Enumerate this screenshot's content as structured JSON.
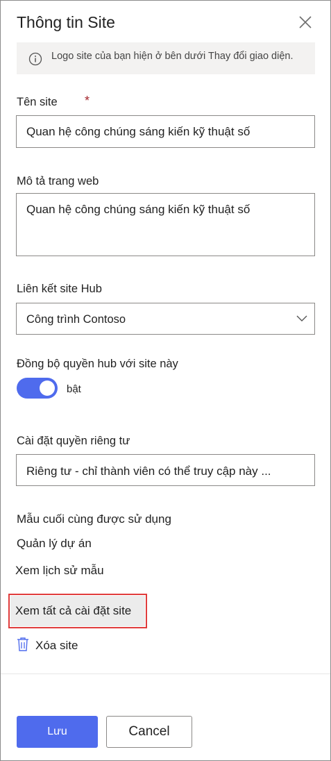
{
  "panel": {
    "title": "Thông tin Site"
  },
  "info_bar": {
    "text": "Logo site của bạn hiện ở bên dưới Thay đổi giao diện."
  },
  "site_name": {
    "label": "Tên site",
    "required_marker": "*",
    "value": "Quan hệ công chúng sáng kiến kỹ thuật số"
  },
  "description": {
    "label": "Mô tả trang web",
    "value": "Quan hệ công chúng sáng kiến kỹ thuật số"
  },
  "hub": {
    "label": "Liên kết site Hub",
    "selected": "Công trình Contoso"
  },
  "hub_sync": {
    "label": "Đồng bộ quyền hub với site này",
    "toggle_state": "bật",
    "on": true
  },
  "privacy": {
    "label": "Cài đặt quyền riêng tư",
    "selected": "Riêng tư - chỉ thành viên có thể truy cập này ..."
  },
  "template": {
    "label": "Mẫu cuối cùng được sử dụng",
    "value": "Quản lý dự án",
    "history_link": "Xem lịch sử mẫu"
  },
  "links": {
    "all_settings": "Xem tất cả cài đặt site",
    "delete_site": "Xóa site"
  },
  "footer": {
    "save": "Lưu",
    "cancel": "Cancel"
  },
  "colors": {
    "accent": "#4f6bed",
    "highlight_border": "#e03c3c",
    "required": "#a4262c"
  },
  "icons": [
    "close-icon",
    "info-icon",
    "chevron-down-icon",
    "trash-icon"
  ]
}
